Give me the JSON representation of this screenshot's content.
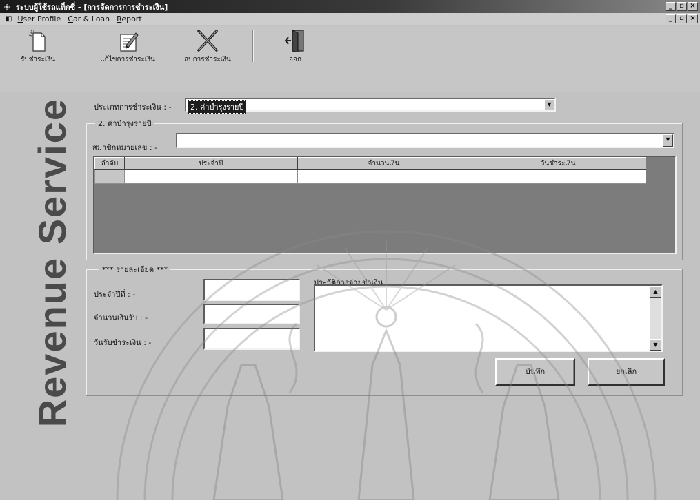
{
  "window": {
    "title": "ระบบผู้ใช้รถแท็กซี่ - [การจัดการการชำระเงิน]",
    "min": "_",
    "max": "▫",
    "close": "×"
  },
  "menu": {
    "items": [
      "User Profile",
      "Car & Loan",
      "Report"
    ]
  },
  "toolbar": {
    "receive_label": "รับชำระเงิน",
    "edit_label": "แก้ไขการชำระเงิน",
    "delete_label": "ลบการชำระเงิน",
    "exit_label": "ออก"
  },
  "banner": {
    "text": "Revenue Service"
  },
  "payment_type": {
    "label": "ประเภทการชำระเงิน : -",
    "value": "2. ค่าบำรุงรายปี"
  },
  "group": {
    "title": "2. ค่าบำรุงรายปี",
    "member_label": "สมาชิกหมายเลข : -",
    "member_value": ""
  },
  "grid": {
    "columns": [
      "ลำดับ",
      "ประจำปี",
      "จำนวนเงิน",
      "วันชำระเงิน"
    ]
  },
  "details": {
    "title": "*** รายละเอียด ***",
    "year_label": "ประจำปีที่ : -",
    "amount_label": "จำนวนเงินรับ : -",
    "date_label": "วันรับชำระเงิน : -",
    "history_label": "ประวัติการจ่ายชำเงิน"
  },
  "buttons": {
    "save_label": "บันทึก",
    "cancel_label": "ยกเลิก"
  }
}
